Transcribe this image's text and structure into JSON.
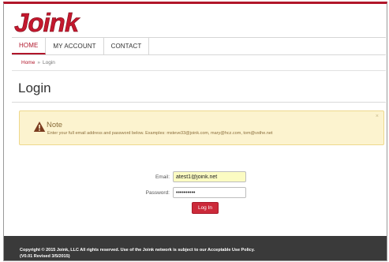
{
  "brand": {
    "name": "Joink",
    "color": "#b1162a"
  },
  "nav": {
    "items": [
      {
        "label": "HOME",
        "active": true
      },
      {
        "label": "MY ACCOUNT",
        "active": false
      },
      {
        "label": "CONTACT",
        "active": false
      }
    ]
  },
  "breadcrumb": {
    "home": "Home",
    "separator": "»",
    "current": "Login"
  },
  "page": {
    "title": "Login"
  },
  "alert": {
    "icon": "warning-icon",
    "title": "Note",
    "text": "Enter your full email address and password below. Examples: msteve33@joink.com, mary@hcz.com, tom@vsthe.net",
    "close": "×",
    "bg_color": "#fcf3cf"
  },
  "form": {
    "email_label": "Email:",
    "email_value": "atest1@joink.net",
    "password_label": "Password:",
    "password_value": "••••••••••",
    "submit_label": "Log In",
    "button_color": "#cc2a3a"
  },
  "footer": {
    "line1": "Copyright © 2015 Joink, LLC All rights reserved. Use of the Joink network is subject to our Acceptable Use Policy.",
    "line2": "(V0.01 Revised 3/5/2015)"
  }
}
